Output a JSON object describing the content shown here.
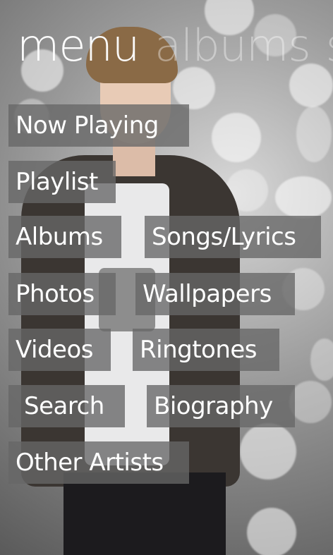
{
  "header": {
    "pivots": [
      {
        "label": "menu",
        "active": true
      },
      {
        "label": "albums",
        "active": false
      },
      {
        "label": "s",
        "active": false
      }
    ]
  },
  "menu": {
    "items": [
      {
        "label": "Now Playing"
      },
      {
        "label": "Playlist"
      },
      {
        "label": "Albums"
      },
      {
        "label": "Songs/Lyrics"
      },
      {
        "label": "Photos"
      },
      {
        "label": "Wallpapers"
      },
      {
        "label": "Videos"
      },
      {
        "label": "Ringtones"
      },
      {
        "label": "Search"
      },
      {
        "label": "Biography"
      },
      {
        "label": "Other Artists"
      }
    ]
  },
  "theme": {
    "tile_color": "#666666",
    "text_color": "#ffffff"
  }
}
